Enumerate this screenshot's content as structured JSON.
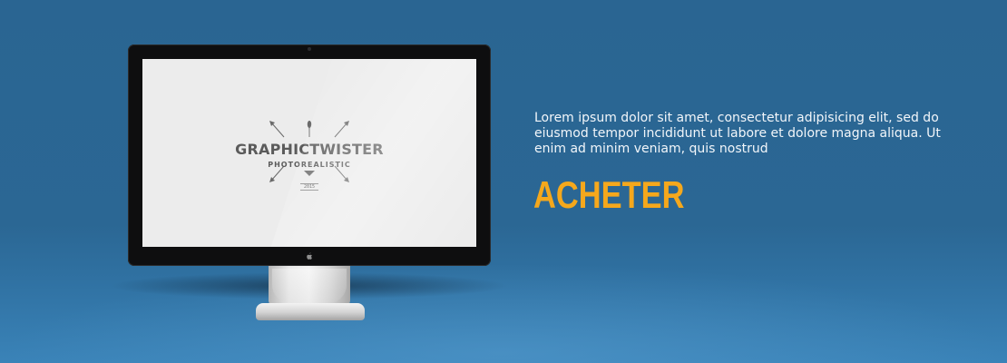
{
  "hero": {
    "background_color": "#2b6794",
    "description": "Lorem ipsum dolor sit amet, consectetur adipisicing elit, sed do eiusmod tempor incididunt ut labore et dolore magna aliqua. Ut enim ad minim veniam, quis nostrud",
    "cta": {
      "label": "ACHETER",
      "color": "#f5a81c"
    }
  },
  "monitor": {
    "screen": {
      "logo": {
        "brand": "GRAPHICTWISTER",
        "tagline": "PHOTOREALISTIC",
        "year": "2015"
      }
    },
    "bezel_icon": "apple-icon"
  }
}
